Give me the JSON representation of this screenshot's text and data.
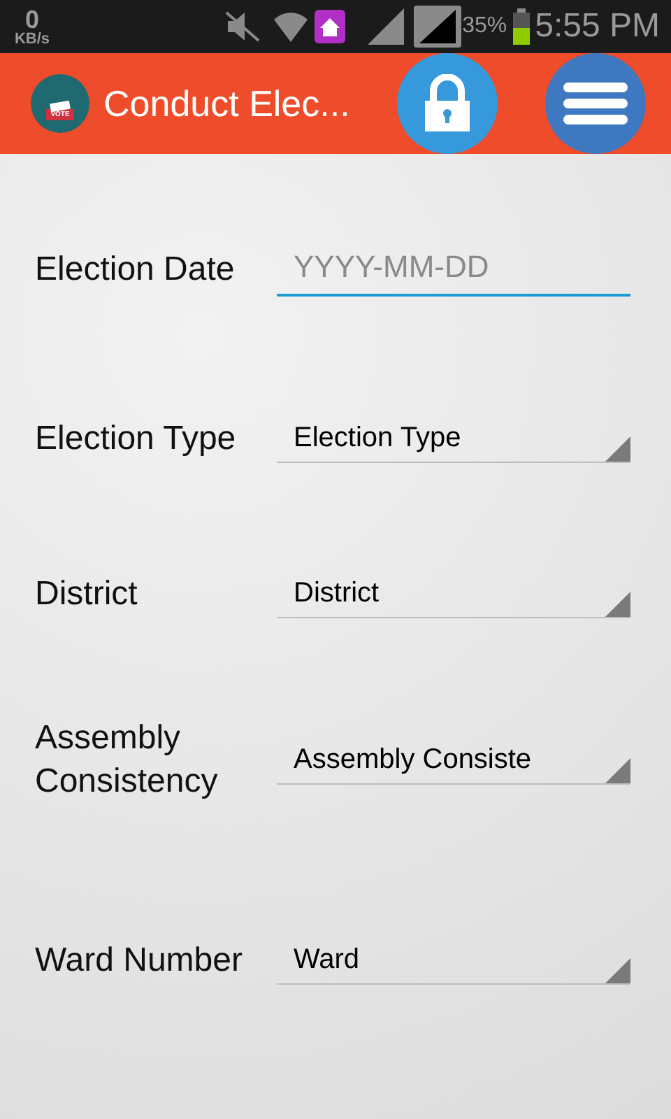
{
  "status_bar": {
    "speed_value": "0",
    "speed_unit": "KB/s",
    "battery": "35%",
    "time": "5:55 PM"
  },
  "app_bar": {
    "logo_text": "VOTE",
    "title": "Conduct Elec..."
  },
  "form": [
    {
      "kind": "date",
      "label": "Election Date",
      "placeholder": "YYYY-MM-DD",
      "focused": true
    },
    {
      "kind": "select",
      "label": "Election Type",
      "value": "Election Type"
    },
    {
      "kind": "select",
      "label": "District",
      "value": "District"
    },
    {
      "kind": "select",
      "label": "Assembly Consistency",
      "value": "Assembly Consiste"
    },
    {
      "kind": "select",
      "label": "Ward Number",
      "value": "Ward"
    }
  ]
}
